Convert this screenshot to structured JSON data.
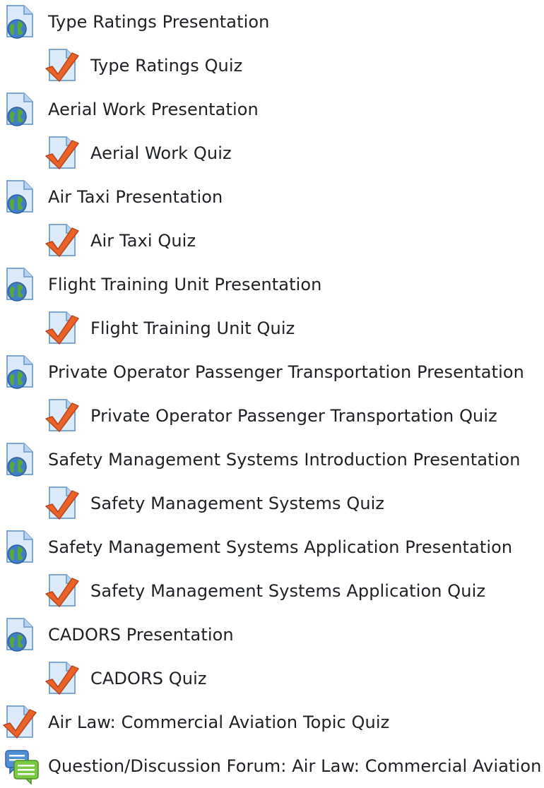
{
  "items": [
    {
      "type": "presentation",
      "icon": "globe-page-icon",
      "label": "Type Ratings Presentation"
    },
    {
      "type": "quiz",
      "icon": "quiz-checkmark-icon",
      "label": "Type Ratings Quiz"
    },
    {
      "type": "presentation",
      "icon": "globe-page-icon",
      "label": "Aerial Work Presentation"
    },
    {
      "type": "quiz",
      "icon": "quiz-checkmark-icon",
      "label": "Aerial Work Quiz"
    },
    {
      "type": "presentation",
      "icon": "globe-page-icon",
      "label": "Air Taxi Presentation"
    },
    {
      "type": "quiz",
      "icon": "quiz-checkmark-icon",
      "label": "Air Taxi Quiz"
    },
    {
      "type": "presentation",
      "icon": "globe-page-icon",
      "label": "Flight Training Unit Presentation"
    },
    {
      "type": "quiz",
      "icon": "quiz-checkmark-icon",
      "label": "Flight Training Unit Quiz"
    },
    {
      "type": "presentation",
      "icon": "globe-page-icon",
      "label": "Private Operator Passenger Transportation Presentation"
    },
    {
      "type": "quiz",
      "icon": "quiz-checkmark-icon",
      "label": "Private Operator Passenger Transportation Quiz"
    },
    {
      "type": "presentation",
      "icon": "globe-page-icon",
      "label": "Safety Management Systems Introduction Presentation"
    },
    {
      "type": "quiz",
      "icon": "quiz-checkmark-icon",
      "label": "Safety Management Systems Quiz"
    },
    {
      "type": "presentation",
      "icon": "globe-page-icon",
      "label": "Safety Management Systems Application Presentation"
    },
    {
      "type": "quiz",
      "icon": "quiz-checkmark-icon",
      "label": "Safety Management Systems Application Quiz"
    },
    {
      "type": "presentation",
      "icon": "globe-page-icon",
      "label": "CADORS Presentation"
    },
    {
      "type": "quiz",
      "icon": "quiz-checkmark-icon",
      "label": "CADORS Quiz"
    },
    {
      "type": "topic-quiz",
      "icon": "quiz-checkmark-icon",
      "label": "Air Law: Commercial Aviation Topic Quiz"
    },
    {
      "type": "forum",
      "icon": "forum-chat-icon",
      "label": "Question/Discussion Forum: Air Law: Commercial Aviation"
    }
  ],
  "colors": {
    "text": "#1d2125",
    "page_fill": "#dbe9f8",
    "page_stroke": "#7fa7d4",
    "globe_blue": "#3f7fc9",
    "globe_green": "#5aa83a",
    "check_orange": "#e8622a",
    "forum_blue": "#4f8fd8",
    "forum_green": "#7ac943"
  }
}
